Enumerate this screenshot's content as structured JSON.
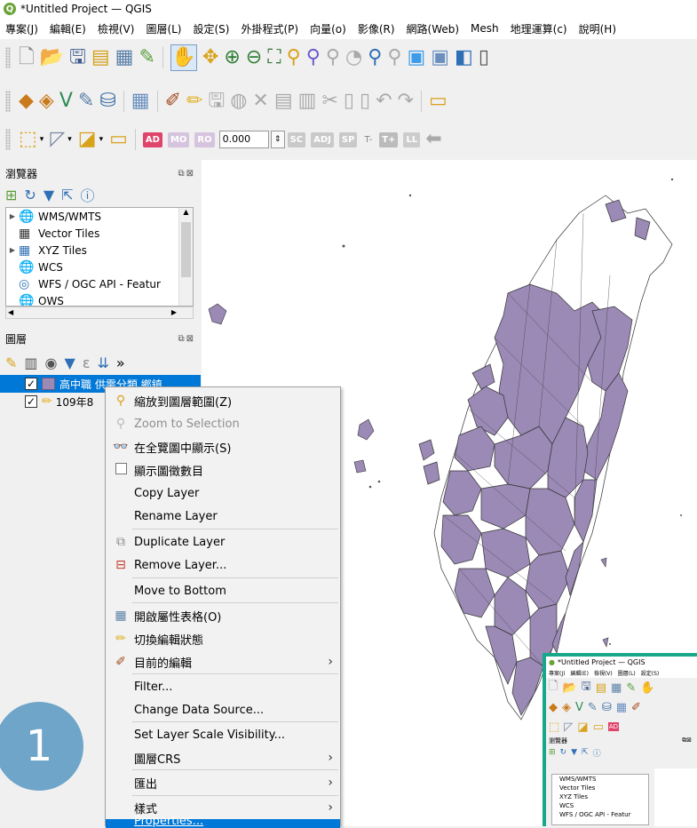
{
  "window": {
    "title": "*Untitled Project — QGIS",
    "logo_letter": "Q"
  },
  "menubar": [
    "專案(J)",
    "編輯(E)",
    "檢視(V)",
    "圖層(L)",
    "設定(S)",
    "外掛程式(P)",
    "向量(o)",
    "影像(R)",
    "網路(Web)",
    "Mesh",
    "地理運算(c)",
    "說明(H)"
  ],
  "digitize_toolbar": {
    "ad": "AD",
    "mo": "MO",
    "ro": "RO",
    "value": "0.000",
    "sc": "SC",
    "adj": "ADJ",
    "sp": "SP",
    "t_minus": "T-",
    "t_plus": "T+",
    "ll": "LL"
  },
  "browser_panel": {
    "title": "瀏覽器",
    "items": [
      {
        "label": "WMS/WMTS",
        "expandable": true
      },
      {
        "label": "Vector Tiles",
        "expandable": false
      },
      {
        "label": "XYZ Tiles",
        "expandable": true
      },
      {
        "label": "WCS",
        "expandable": false
      },
      {
        "label": "WFS / OGC API - Featur",
        "expandable": false
      },
      {
        "label": "OWS",
        "expandable": false
      }
    ]
  },
  "layers_panel": {
    "title": "圖層",
    "more": "»",
    "layers": [
      {
        "name": "高中職 供需分類 鄉鎮",
        "checked": true,
        "selected": true
      },
      {
        "name": "109年8",
        "checked": true,
        "selected": false
      }
    ]
  },
  "context_menu": {
    "zoom_to_layer": "縮放到圖層範圍(Z)",
    "zoom_to_selection": "Zoom to Selection",
    "show_in_overview": "在全覽圖中顯示(S)",
    "show_feature_count": "顯示圖徵數目",
    "copy_layer": "Copy Layer",
    "rename_layer": "Rename Layer",
    "duplicate_layer": "Duplicate Layer",
    "remove_layer": "Remove Layer...",
    "move_to_bottom": "Move to Bottom",
    "open_attribute_table": "開啟屬性表格(O)",
    "toggle_editing": "切換編輯狀態",
    "current_edits": "目前的編輯",
    "filter": "Filter...",
    "change_data_source": "Change Data Source...",
    "set_scale_visibility": "Set Layer Scale Visibility...",
    "layer_crs": "圖層CRS",
    "export": "匯出",
    "styles": "樣式",
    "properties": "Properties..."
  },
  "step_badge": "1",
  "thumbnail": {
    "title": "*Untitled Project — QGIS",
    "menu": [
      "專案(J)",
      "編輯(E)",
      "檢視(V)",
      "圖層(L)",
      "設定(S)"
    ],
    "panel_title": "瀏覽器",
    "items": [
      "WMS/WMTS",
      "Vector Tiles",
      "XYZ Tiles",
      "WCS",
      "WFS / OGC API - Featur"
    ]
  },
  "colors": {
    "polygon_fill": "#9b89b6",
    "selection": "#0078d7",
    "badge": "#6fa5c9",
    "thumb_border": "#17a88b",
    "edit_red": "#e0446a"
  }
}
